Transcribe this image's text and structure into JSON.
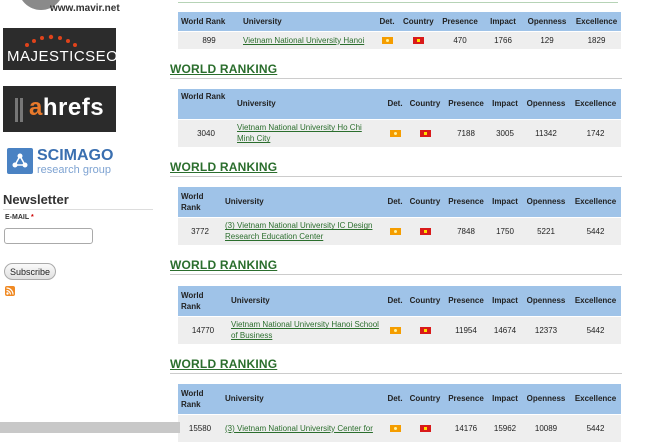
{
  "sidebar": {
    "site_url": "www.mavir.net",
    "badges": {
      "majestic": "MAJESTICSEO",
      "ahrefs_a": "a",
      "ahrefs_rest": "hrefs",
      "scimago_main": "SCIMAGO",
      "scimago_sub": "research group"
    },
    "newsletter": {
      "title": "Newsletter",
      "email_label": "E-MAIL",
      "required_mark": "*",
      "email_value": "",
      "subscribe_label": "Subscribe"
    }
  },
  "section_heading": "WORLD RANKING",
  "columns": [
    "World Rank",
    "University",
    "Det.",
    "Country",
    "Presence",
    "Impact",
    "Openness",
    "Excellence"
  ],
  "rankings": [
    {
      "rank": "899",
      "university": "Vietnam National University Hanoi",
      "presence": "470",
      "impact": "1766",
      "openness": "129",
      "excellence": "1829"
    },
    {
      "rank": "3040",
      "university": "Vietnam National University Ho Chi Minh City",
      "presence": "7188",
      "impact": "3005",
      "openness": "11342",
      "excellence": "1742"
    },
    {
      "rank": "3772",
      "university": "(3) Vietnam National University IC Design Research Education Center",
      "presence": "7848",
      "impact": "1750",
      "openness": "5221",
      "excellence": "5442"
    },
    {
      "rank": "14770",
      "university": "Vietnam National University Hanoi School of Business",
      "presence": "11954",
      "impact": "14674",
      "openness": "12373",
      "excellence": "5442"
    },
    {
      "rank": "15580",
      "university": "(3) Vietnam National University Center for",
      "presence": "14176",
      "impact": "15962",
      "openness": "10089",
      "excellence": "5442"
    }
  ],
  "colors": {
    "header_bg": "#9fc3e8",
    "row_bg": "#eeeeee",
    "heading_green": "#2b6e2d",
    "link_green": "#2b6e2d"
  }
}
